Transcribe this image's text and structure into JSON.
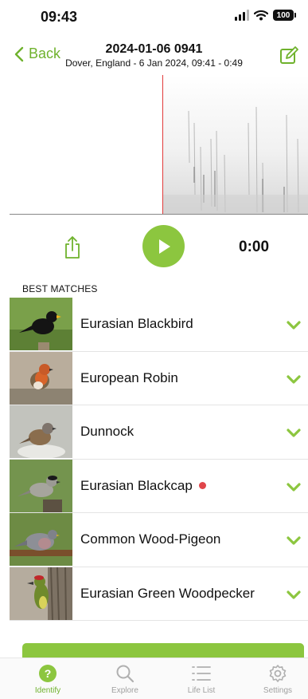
{
  "status_bar": {
    "time": "09:43",
    "battery": "100"
  },
  "header": {
    "back_label": "Back",
    "title": "2024-01-06 0941",
    "subtitle": "Dover, England - 6 Jan 2024, 09:41 - 0:49"
  },
  "player": {
    "time": "0:00"
  },
  "matches": {
    "heading": "BEST MATCHES",
    "items": [
      {
        "name": "Eurasian Blackbird",
        "dot": false
      },
      {
        "name": "European Robin",
        "dot": false
      },
      {
        "name": "Dunnock",
        "dot": false
      },
      {
        "name": "Eurasian Blackcap",
        "dot": true
      },
      {
        "name": "Common Wood-Pigeon",
        "dot": false
      },
      {
        "name": "Eurasian Green Woodpecker",
        "dot": false
      }
    ]
  },
  "tabs": [
    {
      "label": "Identify",
      "icon": "question-icon",
      "active": true
    },
    {
      "label": "Explore",
      "icon": "magnifier-icon",
      "active": false
    },
    {
      "label": "Life List",
      "icon": "list-icon",
      "active": false
    },
    {
      "label": "Settings",
      "icon": "gear-icon",
      "active": false
    }
  ],
  "colors": {
    "accent": "#8cc63f",
    "accent_text": "#6fb22d",
    "playhead": "#e23b3b",
    "new_species_dot": "#e0454a"
  }
}
